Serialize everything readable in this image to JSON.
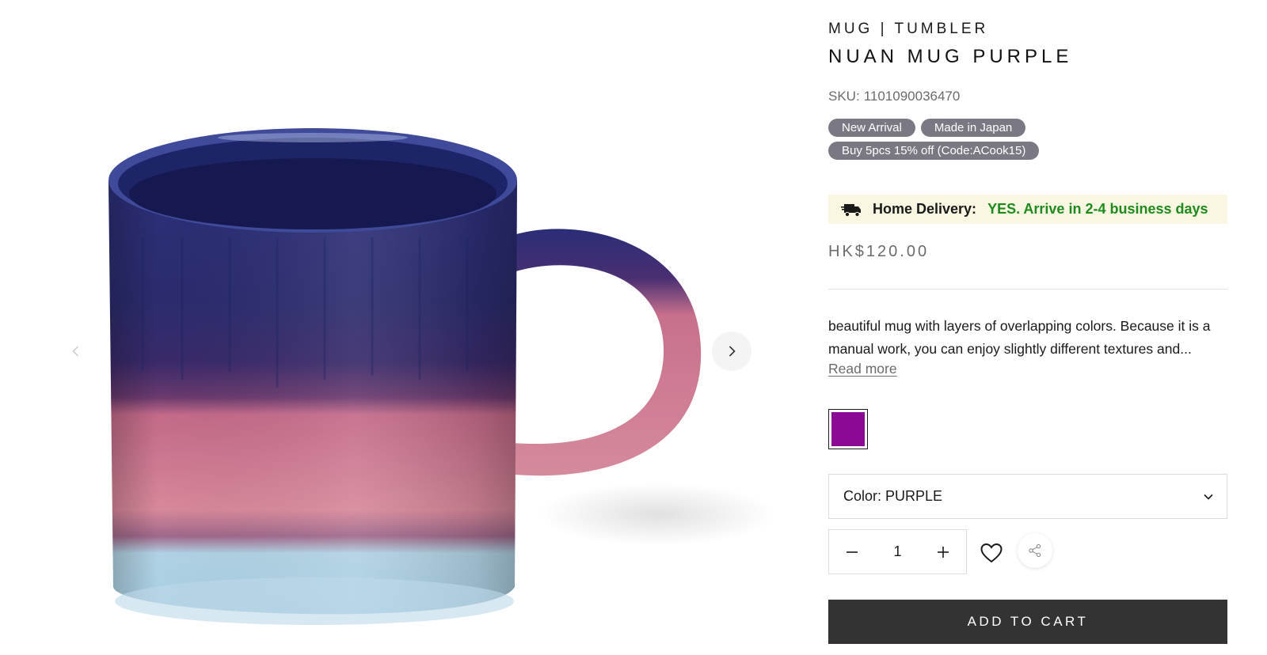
{
  "product": {
    "category": "MUG | TUMBLER",
    "title": "NUAN MUG PURPLE",
    "sku_label": "SKU:",
    "sku_value": "1101090036470",
    "badges": [
      "New Arrival",
      "Made in Japan",
      "Buy 5pcs 15% off (Code:ACook15)"
    ],
    "delivery": {
      "icon": "truck-icon",
      "label": "Home Delivery:",
      "status": "YES. Arrive in 2-4 business days",
      "status_color": "#1f8a1f",
      "background": "#f9f6e1"
    },
    "price": "HK$120.00",
    "description": "beautiful mug with layers of overlapping colors. Because it is a manual work, you can enjoy slightly different textures and...",
    "read_more": "Read more",
    "swatch": {
      "name": "PURPLE",
      "color": "#8a0a96"
    },
    "color_select": {
      "prefix": "Color:",
      "value": "PURPLE"
    },
    "quantity": "1",
    "add_to_cart": "ADD TO CART"
  },
  "gallery": {
    "image": "mug-image",
    "prev_icon": "chevron-left-icon",
    "next_icon": "chevron-right-icon"
  },
  "colors": {
    "badge_bg": "#7a7882",
    "button_bg": "#333333",
    "price": "#6b6b6b"
  }
}
